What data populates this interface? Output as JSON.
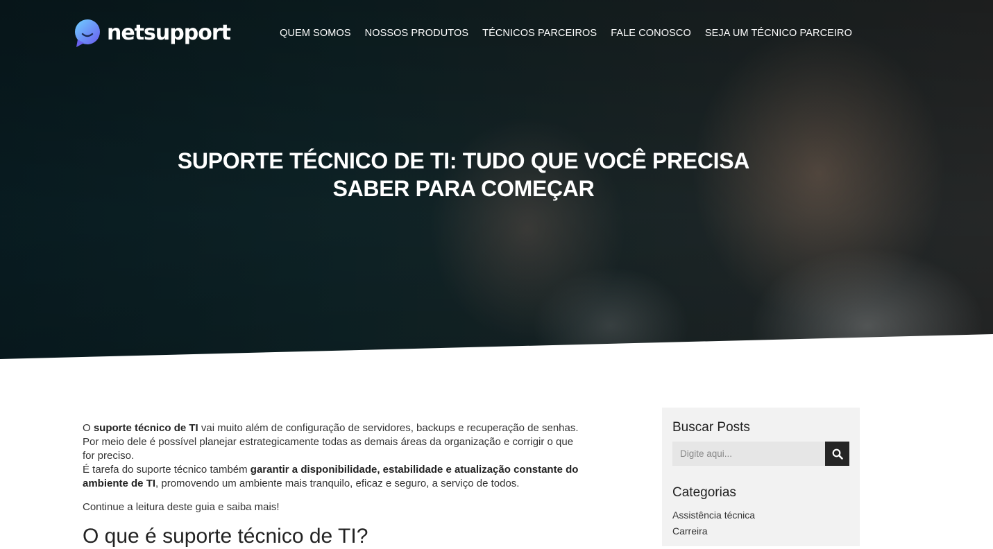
{
  "brand": {
    "name": "netsupport",
    "accent": "#3aa3f0"
  },
  "nav": {
    "items": [
      {
        "label": "QUEM SOMOS"
      },
      {
        "label": "NOSSOS PRODUTOS"
      },
      {
        "label": "TÉCNICOS PARCEIROS"
      },
      {
        "label": "FALE CONOSCO"
      },
      {
        "label": "SEJA UM TÉCNICO PARCEIRO"
      }
    ]
  },
  "hero": {
    "title_line1": "SUPORTE TÉCNICO DE TI: TUDO QUE VOCÊ PRECISA",
    "title_line2": "SABER PARA COMEÇAR"
  },
  "article": {
    "p1_prefix": "O ",
    "p1_bold": "suporte técnico de TI",
    "p1_suffix": " vai muito além de configuração de servidores, backups e recuperação de senhas. Por meio dele é possível planejar estrategicamente todas as demais áreas da organização e corrigir o que for preciso.",
    "p1b_prefix": "É tarefa do suporte técnico também ",
    "p1b_bold": "garantir a disponibilidade, estabilidade e atualização constante do ambiente de TI",
    "p1b_suffix": ", promovendo um ambiente mais tranquilo, eficaz e seguro, a serviço de todos.",
    "p2": "Continue a leitura deste guia e saiba mais!",
    "h2": "O que é suporte técnico de TI?"
  },
  "sidebar": {
    "search_title": "Buscar Posts",
    "search_placeholder": "Digite aqui...",
    "search_icon": "search-icon",
    "categories_title": "Categorias",
    "categories": [
      {
        "label": "Assistência técnica"
      },
      {
        "label": "Carreira"
      }
    ]
  }
}
